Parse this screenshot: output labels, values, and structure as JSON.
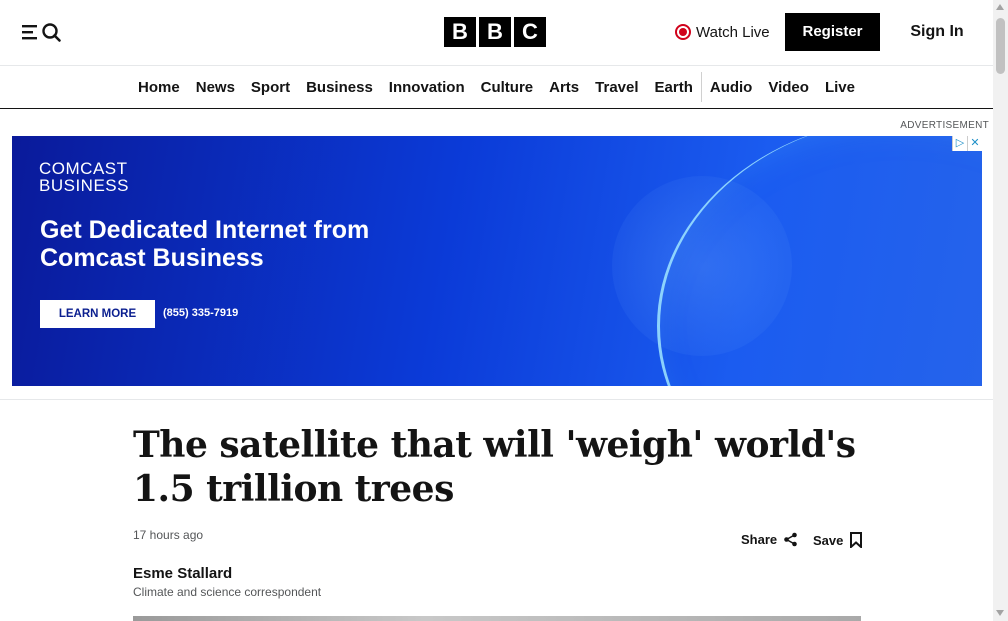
{
  "header": {
    "menu_icon": "menu-icon",
    "search_icon": "search-icon",
    "logo_letters": [
      "B",
      "B",
      "C"
    ],
    "watch_live": "Watch Live",
    "register": "Register",
    "sign_in": "Sign In"
  },
  "nav": {
    "items": [
      "Home",
      "News",
      "Sport",
      "Business",
      "Innovation",
      "Culture",
      "Arts",
      "Travel",
      "Earth",
      "Audio",
      "Video",
      "Live"
    ]
  },
  "ad": {
    "label": "ADVERTISEMENT",
    "brand_line1": "COMCAST",
    "brand_line2": "BUSINESS",
    "headline": "Get Dedicated Internet from Comcast Business",
    "cta": "LEARN MORE",
    "phone": "(855) 335-7919",
    "adchoices_icon": "play-triangle-icon",
    "close_icon": "close-icon"
  },
  "article": {
    "headline": "The satellite that will 'weigh' world's 1.5 trillion trees",
    "timestamp": "17 hours ago",
    "share": "Share",
    "save": "Save",
    "author": "Esme Stallard",
    "author_role": "Climate and science correspondent"
  },
  "colors": {
    "brand_black": "#000000",
    "live_red": "#d0021b",
    "ad_blue": "#0b3bd8",
    "text": "#141414",
    "muted": "#545658"
  }
}
